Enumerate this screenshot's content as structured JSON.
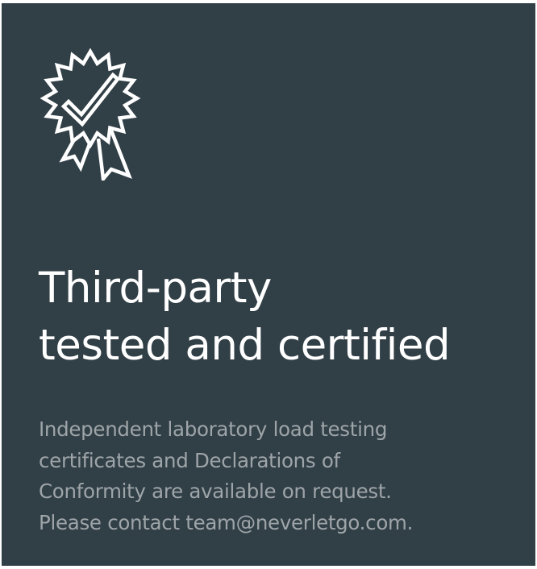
{
  "icon": "certified-badge-icon",
  "colors": {
    "background": "#313f46",
    "title": "#ffffff",
    "body": "#9ea5a9",
    "icon_stroke": "#ffffff"
  },
  "heading": {
    "line1": "Third-party",
    "line2": "tested and certified"
  },
  "description": {
    "line1": "Independent laboratory load testing",
    "line2": "certificates and Declarations of",
    "line3": "Conformity are available on request.",
    "line4": "Please contact team@neverletgo.com."
  }
}
